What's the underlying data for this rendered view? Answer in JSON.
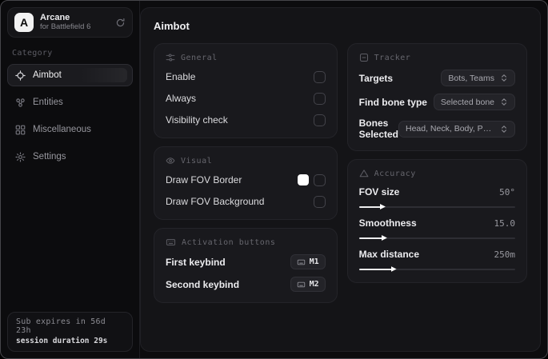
{
  "app": {
    "name": "Arcane",
    "subtitle": "for Battlefield 6",
    "avatar_initial": "A"
  },
  "sidebar": {
    "category_label": "Category",
    "items": [
      {
        "label": "Aimbot",
        "active": true
      },
      {
        "label": "Entities",
        "active": false
      },
      {
        "label": "Miscellaneous",
        "active": false
      },
      {
        "label": "Settings",
        "active": false
      }
    ],
    "footer": {
      "expiry": "Sub expires in 56d 23h",
      "session": "session duration 29s"
    }
  },
  "main": {
    "title": "Aimbot",
    "general": {
      "title": "General",
      "rows": [
        {
          "label": "Enable",
          "checked": false
        },
        {
          "label": "Always",
          "checked": false
        },
        {
          "label": "Visibility check",
          "checked": false
        }
      ]
    },
    "visual": {
      "title": "Visual",
      "rows": [
        {
          "label": "Draw FOV Border",
          "swatch": "#ffffff",
          "checked": false
        },
        {
          "label": "Draw FOV Background",
          "checked": false
        }
      ]
    },
    "activation": {
      "title": "Activation buttons",
      "rows": [
        {
          "label": "First keybind",
          "key": "M1"
        },
        {
          "label": "Second keybind",
          "key": "M2"
        }
      ]
    },
    "tracker": {
      "title": "Tracker",
      "rows": [
        {
          "label": "Targets",
          "value": "Bots, Teams"
        },
        {
          "label": "Find bone type",
          "value": "Selected bone"
        },
        {
          "label": "Bones Selected",
          "value": "Head, Neck, Body, Pe..."
        }
      ]
    },
    "accuracy": {
      "title": "Accuracy",
      "rows": [
        {
          "label": "FOV size",
          "value": "50°",
          "percent": 15
        },
        {
          "label": "Smoothness",
          "value": "15.0",
          "percent": 16
        },
        {
          "label": "Max distance",
          "value": "250m",
          "percent": 22
        }
      ]
    }
  },
  "colors": {
    "accent_swatch": "#ffffff",
    "panel_bg": "#141417",
    "card_bg": "#19191d",
    "window_bg": "#0c0c0e"
  }
}
